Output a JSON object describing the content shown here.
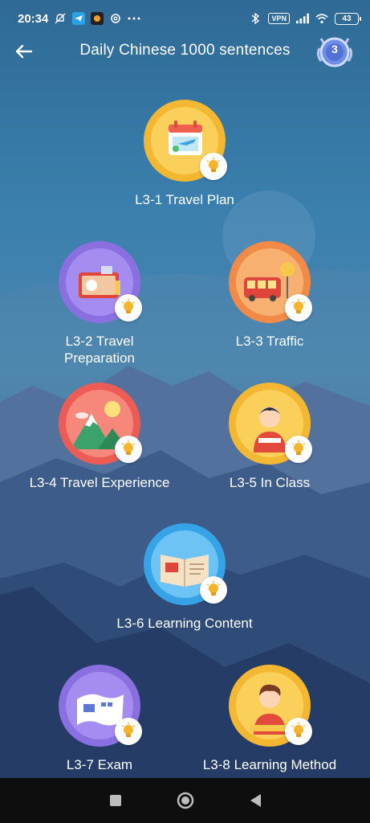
{
  "status": {
    "time": "20:34",
    "vpn": "VPN",
    "battery": "43"
  },
  "header": {
    "title": "Daily Chinese 1000 sentences",
    "level": "3"
  },
  "lessons": [
    {
      "label": "L3-1 Travel Plan",
      "icon": "calendar-plane-icon",
      "ring": "#f4b731",
      "fill": "#fbd05a"
    },
    {
      "label": "L3-2 Travel Preparation",
      "icon": "suitcase-icon",
      "ring": "#8a6fe0",
      "fill": "#a58cf0"
    },
    {
      "label": "L3-3 Traffic",
      "icon": "bus-icon",
      "ring": "#f08a46",
      "fill": "#f7b06f"
    },
    {
      "label": "L3-4 Travel Experience",
      "icon": "mountain-sun-icon",
      "ring": "#ec5c55",
      "fill": "#f6877b"
    },
    {
      "label": "L3-5 In Class",
      "icon": "student-icon",
      "ring": "#f4b731",
      "fill": "#fbd05a"
    },
    {
      "label": "L3-6 Learning Content",
      "icon": "open-book-icon",
      "ring": "#36a3e6",
      "fill": "#6cc3f4"
    },
    {
      "label": "L3-7 Exam",
      "icon": "exam-paper-icon",
      "ring": "#8a6fe0",
      "fill": "#a58cf0"
    },
    {
      "label": "L3-8 Learning Method",
      "icon": "thinking-student-icon",
      "ring": "#f4b731",
      "fill": "#fbd05a"
    }
  ]
}
